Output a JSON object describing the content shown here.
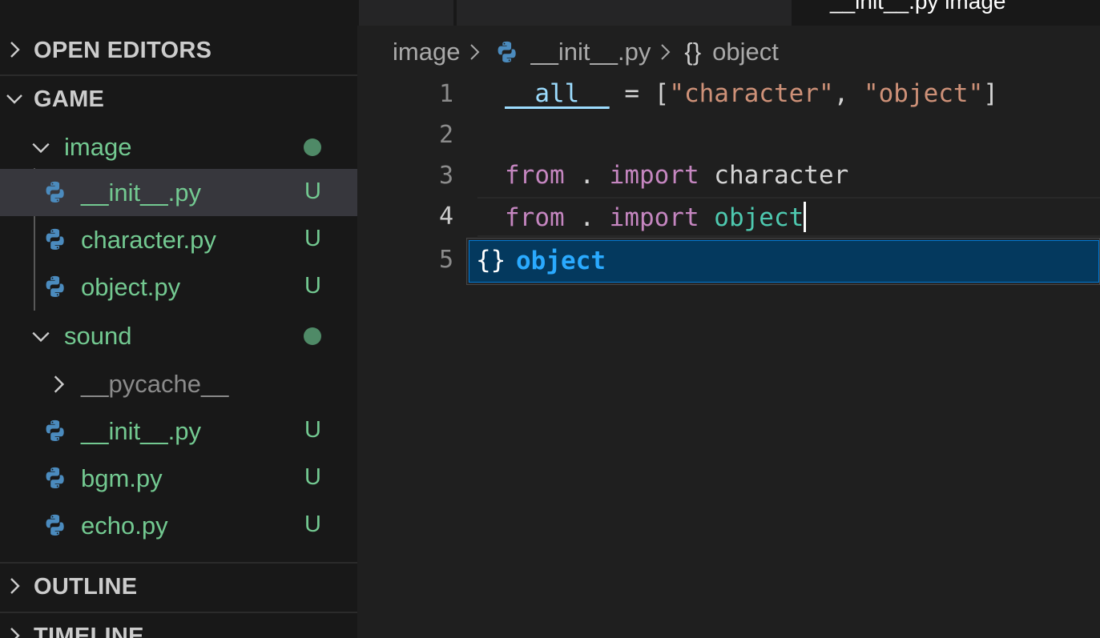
{
  "sidebar": {
    "open_editors": "OPEN EDITORS",
    "workspace": "GAME",
    "tree": [
      {
        "kind": "folder",
        "name": "image",
        "status": "dot"
      },
      {
        "kind": "file",
        "name": "__init__.py",
        "status": "U",
        "selected": true
      },
      {
        "kind": "file",
        "name": "character.py",
        "status": "U"
      },
      {
        "kind": "file",
        "name": "object.py",
        "status": "U"
      },
      {
        "kind": "folder",
        "name": "sound",
        "status": "dot"
      },
      {
        "kind": "folder",
        "name": "__pycache__",
        "status": ""
      },
      {
        "kind": "file",
        "name": "__init__.py",
        "status": "U"
      },
      {
        "kind": "file",
        "name": "bgm.py",
        "status": "U"
      },
      {
        "kind": "file",
        "name": "echo.py",
        "status": "U"
      }
    ],
    "outline": "OUTLINE",
    "timeline": "TIMELINE"
  },
  "tabs": {
    "active_label": "__init__.py image"
  },
  "breadcrumb": {
    "folder": "image",
    "file": "__init__.py",
    "symbol_icon": "{}",
    "symbol": "object"
  },
  "editor": {
    "line_numbers": [
      "1",
      "2",
      "3",
      "4",
      "5"
    ],
    "line1": {
      "var": "__all__",
      "op": " = [",
      "s1": "\"character\"",
      "comma": ", ",
      "s2": "\"object\"",
      "end": "]"
    },
    "line3": {
      "kw1": "from",
      "dot": " . ",
      "kw2": "import",
      "name": " character"
    },
    "line4": {
      "kw1": "from",
      "dot": " . ",
      "kw2": "import",
      "name": " object"
    }
  },
  "suggest": {
    "icon": "{}",
    "label": "object"
  },
  "colors": {
    "sidebar_bg": "#181818",
    "editor_bg": "#1f1f1f",
    "selection": "#37373d",
    "untracked": "#73c991",
    "keyword": "#c586c0",
    "string": "#ce9178",
    "suggest_highlight": "#04395e",
    "suggest_text": "#2aaaff"
  },
  "icons": {
    "chevron_right": "chevron-right-icon",
    "chevron_down": "chevron-down-icon",
    "python": "python-file-icon",
    "modified_dot": "git-status-dot-icon"
  }
}
